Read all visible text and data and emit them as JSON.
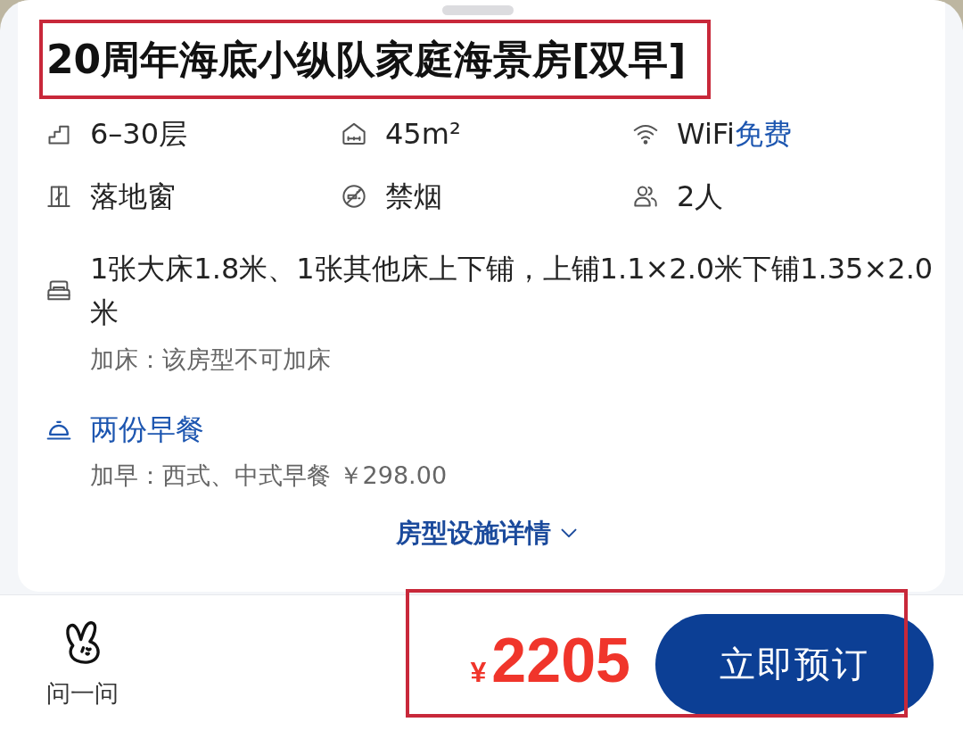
{
  "sheet": {
    "title": {
      "text": "20周年海底小纵队家庭海景房[双早]",
      "highlighted": true
    },
    "facilities": [
      {
        "kind": "floor",
        "text": "6–30层"
      },
      {
        "kind": "area",
        "text": "45m²"
      },
      {
        "kind": "wifi",
        "text": "WiFi",
        "extra": "免费"
      },
      {
        "kind": "window",
        "text": "落地窗"
      },
      {
        "kind": "smoking",
        "text": "禁烟"
      },
      {
        "kind": "guests",
        "text": "2人"
      }
    ],
    "bed": {
      "text": "1张大床1.8米、1张其他床上下铺，上铺1.1×2.0米下铺1.35×2.0米",
      "note": "加床：该房型不可加床"
    },
    "breakfast": {
      "text": "两份早餐",
      "note": "加早：西式、中式早餐 ￥298.00"
    },
    "details_link": "房型设施详情"
  },
  "bottom_bar": {
    "ask": {
      "label": "问一问"
    },
    "price": {
      "currency": "¥",
      "amount": "2205"
    },
    "book_button": "立即预订",
    "highlighted": true
  }
}
